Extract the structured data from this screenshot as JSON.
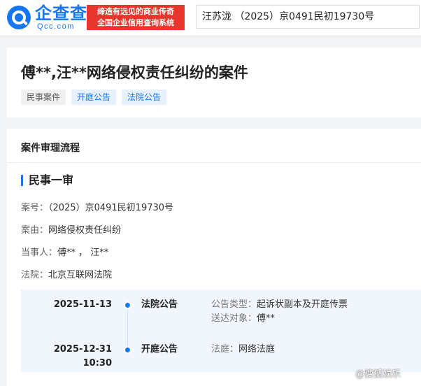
{
  "header": {
    "logo_cn": "企查查",
    "logo_en": "Qcc.com",
    "slogan_line1": "缔造有远见的商业传奇",
    "slogan_line2": "全国企业信用查询系统",
    "search_value": "汪苏泷 （2025）京0491民初19730号"
  },
  "case": {
    "title": "傅**,汪**网络侵权责任纠纷的案件",
    "tags": [
      {
        "label": "民事案件",
        "style": "gray"
      },
      {
        "label": "开庭公告",
        "style": "blue"
      },
      {
        "label": "法院公告",
        "style": "blue"
      }
    ]
  },
  "process": {
    "heading": "案件审理流程",
    "stage": "民事一审",
    "fields": [
      {
        "key": "案号：",
        "value": "（2025）京0491民初19730号"
      },
      {
        "key": "案由：",
        "value": "网络侵权责任纠纷"
      },
      {
        "key": "当事人：",
        "value": "傅** ，  汪**"
      },
      {
        "key": "法院：",
        "value": "北京互联网法院"
      }
    ],
    "timeline": [
      {
        "date": "2025-11-13",
        "time": "",
        "type": "法院公告",
        "details": [
          {
            "key": "公告类型：",
            "value": "起诉状副本及开庭传票"
          },
          {
            "key": "送达对象：",
            "value": "傅**"
          }
        ]
      },
      {
        "date": "2025-12-31",
        "time": "10:30",
        "type": "开庭公告",
        "details": [
          {
            "key": "法庭：",
            "value": "网络法庭"
          }
        ]
      }
    ]
  },
  "watermark": "@搜狐娱乐",
  "colors": {
    "brand_blue": "#1577f0",
    "slogan_red": "#e7362e",
    "timeline_bg": "#f1f6fd"
  }
}
